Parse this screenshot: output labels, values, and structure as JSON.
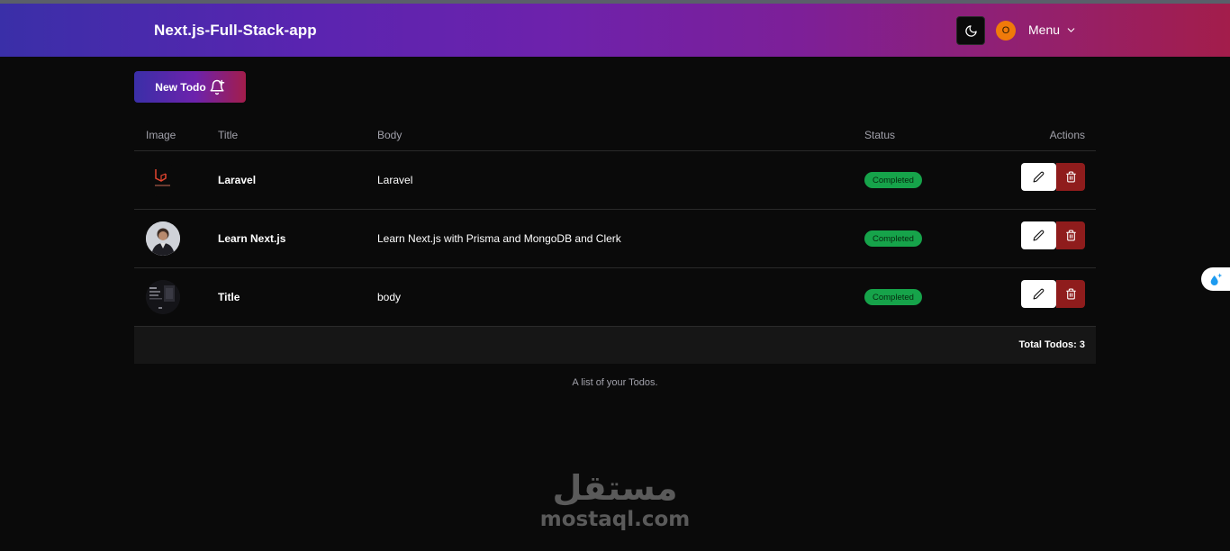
{
  "navbar": {
    "brand": "Next.js-Full-Stack-app",
    "avatar_initial": "O",
    "menu_label": "Menu"
  },
  "actions": {
    "new_todo_label": "New Todo"
  },
  "table": {
    "columns": [
      "Image",
      "Title",
      "Body",
      "Status",
      "Actions"
    ],
    "rows": [
      {
        "image": "laravel-logo",
        "title": "Laravel",
        "body": "Laravel",
        "status": "Completed"
      },
      {
        "image": "person-photo",
        "title": "Learn Next.js",
        "body": "Learn Next.js with Prisma and MongoDB and Clerk",
        "status": "Completed"
      },
      {
        "image": "slide-thumbnail",
        "title": "Title",
        "body": "body",
        "status": "Completed"
      }
    ],
    "footer_total": "Total Todos: 3",
    "caption": "A list of your Todos."
  },
  "watermark": {
    "arabic": "مستقل",
    "latin": "mostaql.com"
  },
  "colors": {
    "gradient_start": "#3a2fa8",
    "gradient_end": "#a31d4b",
    "badge": "#16a34a",
    "delete": "#8f1c1c",
    "background": "#0a0a0a"
  },
  "icons": {
    "theme": "moon-icon",
    "menu": "chevron-down-icon",
    "new_todo": "bell-plus-icon",
    "edit": "pencil-icon",
    "delete": "trash-icon",
    "widget": "sparkle-drop-icon"
  }
}
